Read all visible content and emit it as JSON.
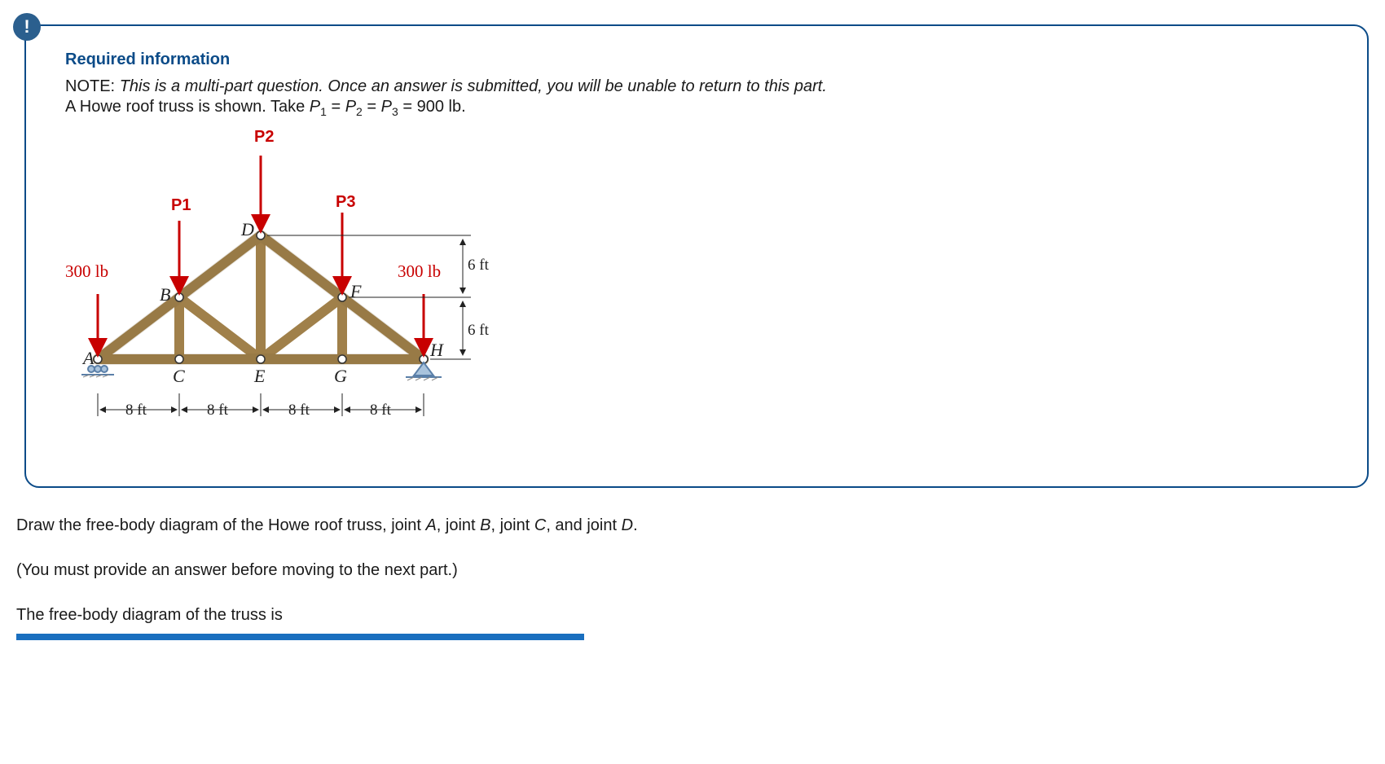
{
  "badge": "!",
  "header": {
    "title": "Required information",
    "note_prefix": "NOTE:",
    "note_body": "This is a multi-part question. Once an answer is submitted, you will be unable to return to this part.",
    "given_a": "A Howe roof truss is shown. Take ",
    "given_b": " = 900 lb."
  },
  "loads": {
    "P1": "P1",
    "P2": "P2",
    "P3": "P3",
    "left": "300 lb",
    "right": "300 lb"
  },
  "nodes": {
    "A": "A",
    "B": "B",
    "C": "C",
    "D": "D",
    "E": "E",
    "F": "F",
    "G": "G",
    "H": "H"
  },
  "dims": {
    "h1": "6 ft",
    "h2": "6 ft",
    "span": "8 ft"
  },
  "question": {
    "line1a": "Draw the free-body diagram of the Howe roof truss, joint ",
    "A": "A",
    "j1": ", joint ",
    "B": "B",
    "j2": ", joint ",
    "C": "C",
    "j3": ", and joint ",
    "D": "D",
    "j4": ".",
    "line2": "(You must provide an answer before moving to the next part.)",
    "line3": "The free-body diagram of the truss is"
  }
}
